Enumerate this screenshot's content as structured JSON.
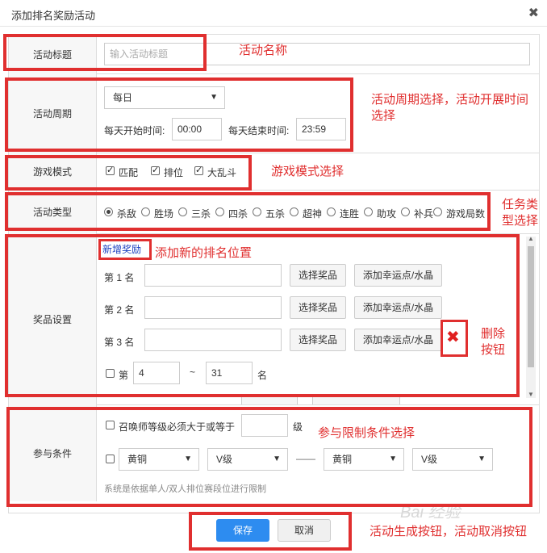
{
  "dialog": {
    "title": "添加排名奖励活动",
    "close_glyph": "✖"
  },
  "rows": {
    "name": {
      "label": "活动标题",
      "placeholder": "输入活动标题"
    },
    "period": {
      "label": "活动周期",
      "select_value": "每日",
      "start_label": "每天开始时间:",
      "start_value": "00:00",
      "end_label": "每天结束时间:",
      "end_value": "23:59"
    },
    "mode": {
      "label": "游戏模式",
      "options": [
        "匹配",
        "排位",
        "大乱斗"
      ]
    },
    "type": {
      "label": "活动类型",
      "options": [
        "杀敌",
        "胜场",
        "三杀",
        "四杀",
        "五杀",
        "超神",
        "连胜",
        "助攻",
        "补兵",
        "游戏局数"
      ],
      "selected": "杀敌"
    },
    "rewards": {
      "label": "奖品设置",
      "add_link": "新增奖励",
      "ranks": [
        "第 1 名",
        "第 2 名",
        "第 3 名"
      ],
      "choose_btn": "选择奖品",
      "lucky_btn": "添加幸运点/水晶",
      "range_prefix": "第",
      "range_from": "4",
      "range_sep": "~",
      "range_to": "31",
      "range_suffix": "名"
    },
    "conditions": {
      "label": "参与条件",
      "level_text": "召唤师等级必须大于或等于",
      "level_unit": "级",
      "tier_from": "黄铜",
      "div_from": "V级",
      "dash": "——",
      "tier_to": "黄铜",
      "div_to": "V级",
      "note": "系统是依据单人/双人排位赛段位进行限制"
    }
  },
  "footer": {
    "save": "保存",
    "cancel": "取消"
  },
  "annotations": {
    "a1": "活动名称",
    "a2_line1": "活动周期选择，活动开展时间",
    "a2_line2": "选择",
    "a3": "游戏模式选择",
    "a4_line1": "任务类",
    "a4_line2": "型选择",
    "a5": "添加新的排名位置",
    "a6_line1": "删除",
    "a6_line2": "按钮",
    "a7": "参与限制条件选择",
    "a8": "活动生成按钮，活动取消按钮"
  },
  "watermark": "Bai 经验",
  "colors": {
    "annotation_red": "#e02f2f",
    "primary_blue": "#2d8cf0",
    "link_blue": "#1a3fbf"
  }
}
